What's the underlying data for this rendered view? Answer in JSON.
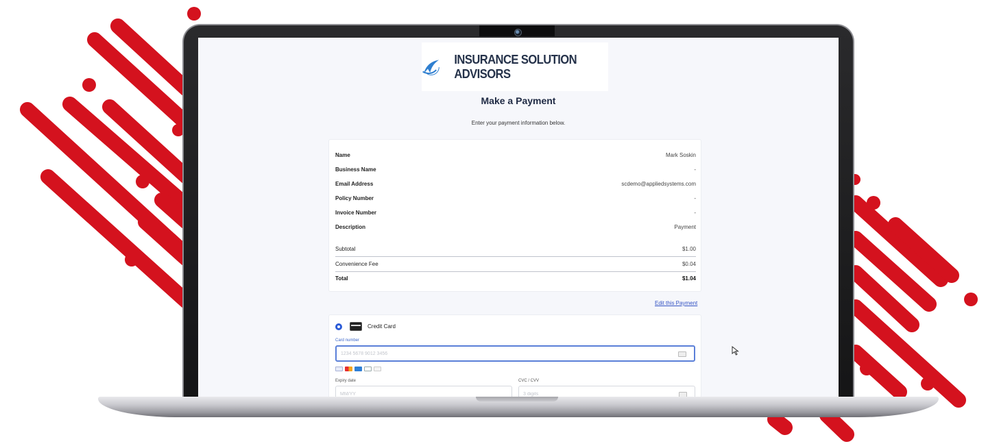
{
  "colors": {
    "accent_red": "#d4121e",
    "screen_bg": "#f6f7fb",
    "link_blue": "#3554c4",
    "radio_blue": "#2b5bd7"
  },
  "logo": {
    "icon": "swoosh-arrow-icon",
    "name": "INSURANCE SOLUTION ADVISORS"
  },
  "page": {
    "title": "Make a Payment",
    "subtitle": "Enter your payment information below."
  },
  "summary": {
    "details": [
      {
        "label": "Name",
        "value": "Mark Soskin"
      },
      {
        "label": "Business Name",
        "value": "-"
      },
      {
        "label": "Email Address",
        "value": "scdemo@appliedsystems.com"
      },
      {
        "label": "Policy Number",
        "value": "-"
      },
      {
        "label": "Invoice Number",
        "value": "-"
      },
      {
        "label": "Description",
        "value": "Payment"
      }
    ],
    "totals": [
      {
        "label": "Subtotal",
        "value": "$1.00"
      },
      {
        "label": "Convenience Fee",
        "value": "$0.04"
      },
      {
        "label": "Total",
        "value": "$1.04"
      }
    ]
  },
  "edit_link": "Edit this Payment",
  "payment": {
    "method_label": "Credit Card",
    "card_number": {
      "label": "Card number",
      "placeholder": "1234 5678 9012 3456"
    },
    "brands": [
      "visa-icon",
      "mastercard-icon",
      "amex-icon",
      "diners-icon",
      "discover-icon"
    ],
    "expiry": {
      "label": "Expiry date",
      "placeholder": "MM/YY"
    },
    "cvc": {
      "label": "CVC / CVV",
      "placeholder": "3 digits"
    }
  }
}
